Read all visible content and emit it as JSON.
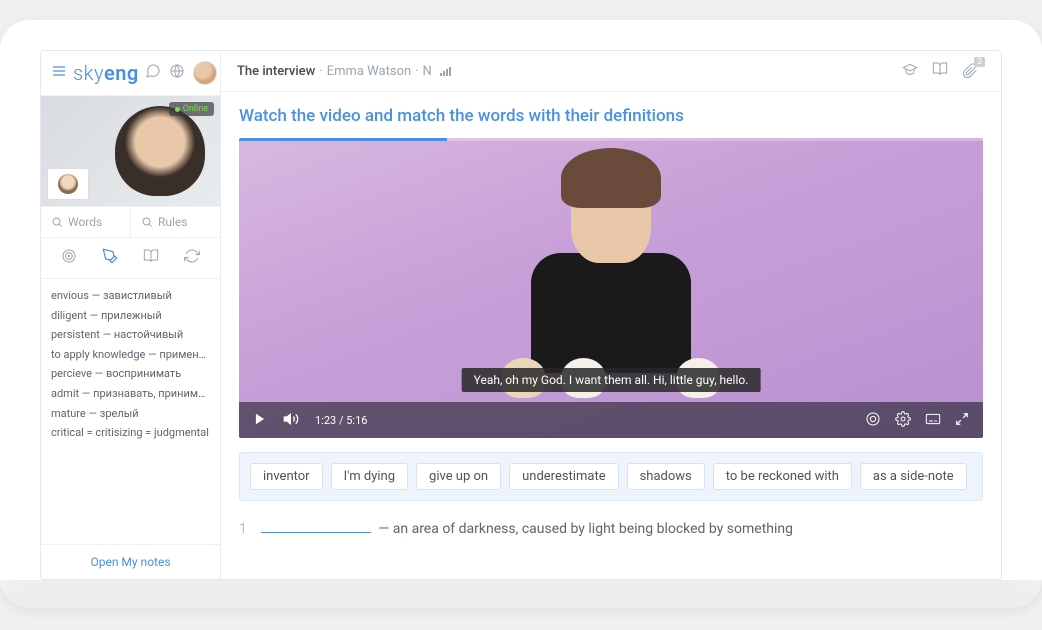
{
  "brand": {
    "sky": "sky",
    "eng": "eng"
  },
  "sidebar": {
    "online_label": "Online",
    "words_placeholder": "Words",
    "rules_placeholder": "Rules",
    "vocab": [
      "envious — завистливый",
      "diligent — прилежный",
      "persistent — настойчивый",
      "to apply knowledge — применять знания",
      "percieve — воспринимать",
      "admit — признавать, принимать",
      "mature — зрелый",
      "critical = critisizing = judgmental"
    ],
    "open_notes": "Open My notes"
  },
  "header": {
    "lesson_title": "The interview",
    "subtitle": "Emma Watson",
    "level": "N",
    "attachments_count": "3"
  },
  "task": {
    "title": "Watch the video and match the words with their definitions"
  },
  "video": {
    "caption": "Yeah, oh my God. I want them all. Hi, little guy, hello.",
    "current_time": "1:23",
    "duration": "5:16"
  },
  "word_bank": [
    "inventor",
    "I'm dying",
    "give up on",
    "underestimate",
    "shadows",
    "to be reckoned with",
    "as a side-note"
  ],
  "question": {
    "number": "1",
    "text_before_blank": "",
    "text_after_blank": "— an area of darkness, caused by light being blocked by something"
  }
}
